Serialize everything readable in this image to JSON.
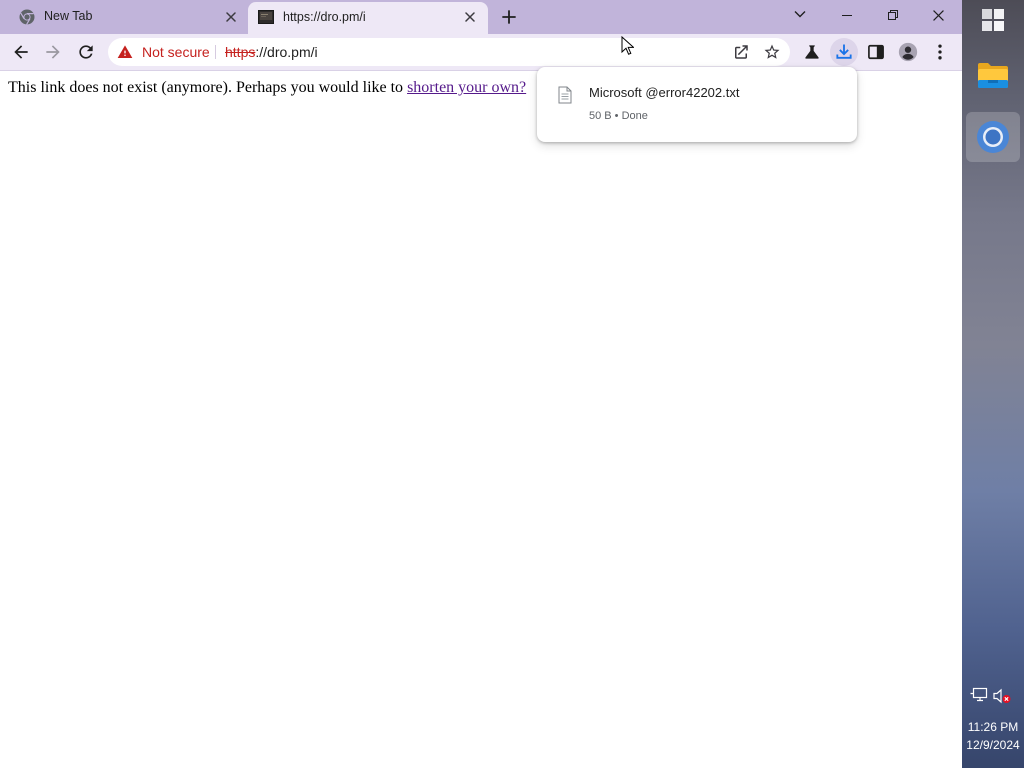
{
  "browser": {
    "tabs": [
      {
        "title": "New Tab",
        "favicon": "chrome-logo-icon",
        "active": false
      },
      {
        "title": "https://dro.pm/i",
        "favicon": "site-favicon-icon",
        "active": true
      }
    ],
    "omnibox": {
      "security_label": "Not secure",
      "url_scheme": "https",
      "url_rest": "://dro.pm/i"
    },
    "toolbar_icons": [
      "back-arrow-icon",
      "forward-arrow-icon",
      "reload-icon",
      "warning-triangle-icon",
      "share-icon",
      "star-icon",
      "labs-flask-icon",
      "download-icon",
      "side-panel-icon",
      "profile-avatar-icon",
      "more-menu-icon"
    ],
    "window_icons": [
      "new-tab-plus-icon",
      "tab-search-chevron-icon",
      "minimize-icon",
      "restore-icon",
      "close-window-icon"
    ]
  },
  "page": {
    "message": "This link does not exist (anymore). Perhaps you would like to ",
    "link_text": "shorten your own?"
  },
  "download_bubble": {
    "file_icon": "text-file-icon",
    "file_name": "Microsoft @error42202.txt",
    "status": "50 B • Done"
  },
  "taskbar": {
    "icons": [
      "start-icon",
      "file-explorer-icon",
      "chromium-icon",
      "network-icon",
      "volume-muted-icon"
    ],
    "time": "11:26 PM",
    "date": "12/9/2024"
  },
  "colors": {
    "tab_strip": "#c1b4da",
    "toolbar": "#eee8f6",
    "omnibox": "#ffffff",
    "insecure_red": "#c5221f",
    "link_visited": "#551a8b",
    "download_blue": "#1a73e8"
  }
}
